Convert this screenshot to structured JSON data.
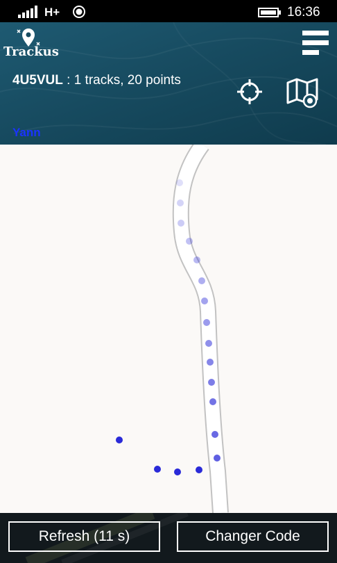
{
  "status_bar": {
    "network": "H+",
    "time": "16:36"
  },
  "header": {
    "app_name": "Trackus",
    "track_code": "4U5VUL",
    "track_summary": " : 1 tracks, 20 points",
    "user_name": "Yann",
    "icons": [
      "menu-icon",
      "locate-icon",
      "map-icon"
    ]
  },
  "footer": {
    "refresh_label": "Refresh (11 s)",
    "change_code_label": "Changer Code"
  },
  "colors": {
    "header_bg": "#174b60",
    "user_name": "#1a33ff",
    "track_point": "#2a2ad8",
    "map_bg": "#fbf9f7"
  }
}
